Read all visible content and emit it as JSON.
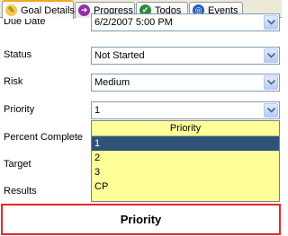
{
  "tabs": [
    {
      "label": "Goal Details",
      "icon": "pencil-icon",
      "active": true
    },
    {
      "label": "Progress",
      "icon": "progress-icon",
      "active": false
    },
    {
      "label": "Todos",
      "icon": "checkmark-icon",
      "active": false
    },
    {
      "label": "Events",
      "icon": "events-icon",
      "active": false
    }
  ],
  "fields": {
    "due_date": {
      "label": "Due Date",
      "value": "6/2/2007 5:00 PM"
    },
    "status": {
      "label": "Status",
      "value": "Not Started"
    },
    "risk": {
      "label": "Risk",
      "value": "Medium"
    },
    "priority": {
      "label": "Priority",
      "value": "1"
    },
    "percent_complete": {
      "label": "Percent Complete"
    },
    "target": {
      "label": "Target"
    },
    "results": {
      "label": "Results"
    }
  },
  "priority_dropdown": {
    "header": "Priority",
    "options": [
      "1",
      "2",
      "3",
      "CP"
    ],
    "selected": "1"
  },
  "status_box": {
    "text": "Priority"
  },
  "colors": {
    "dropdown_bg": "#ffff99",
    "selected_bg": "#2f5277",
    "status_border": "#e12828",
    "active_tab_accent": "#f5a623"
  }
}
